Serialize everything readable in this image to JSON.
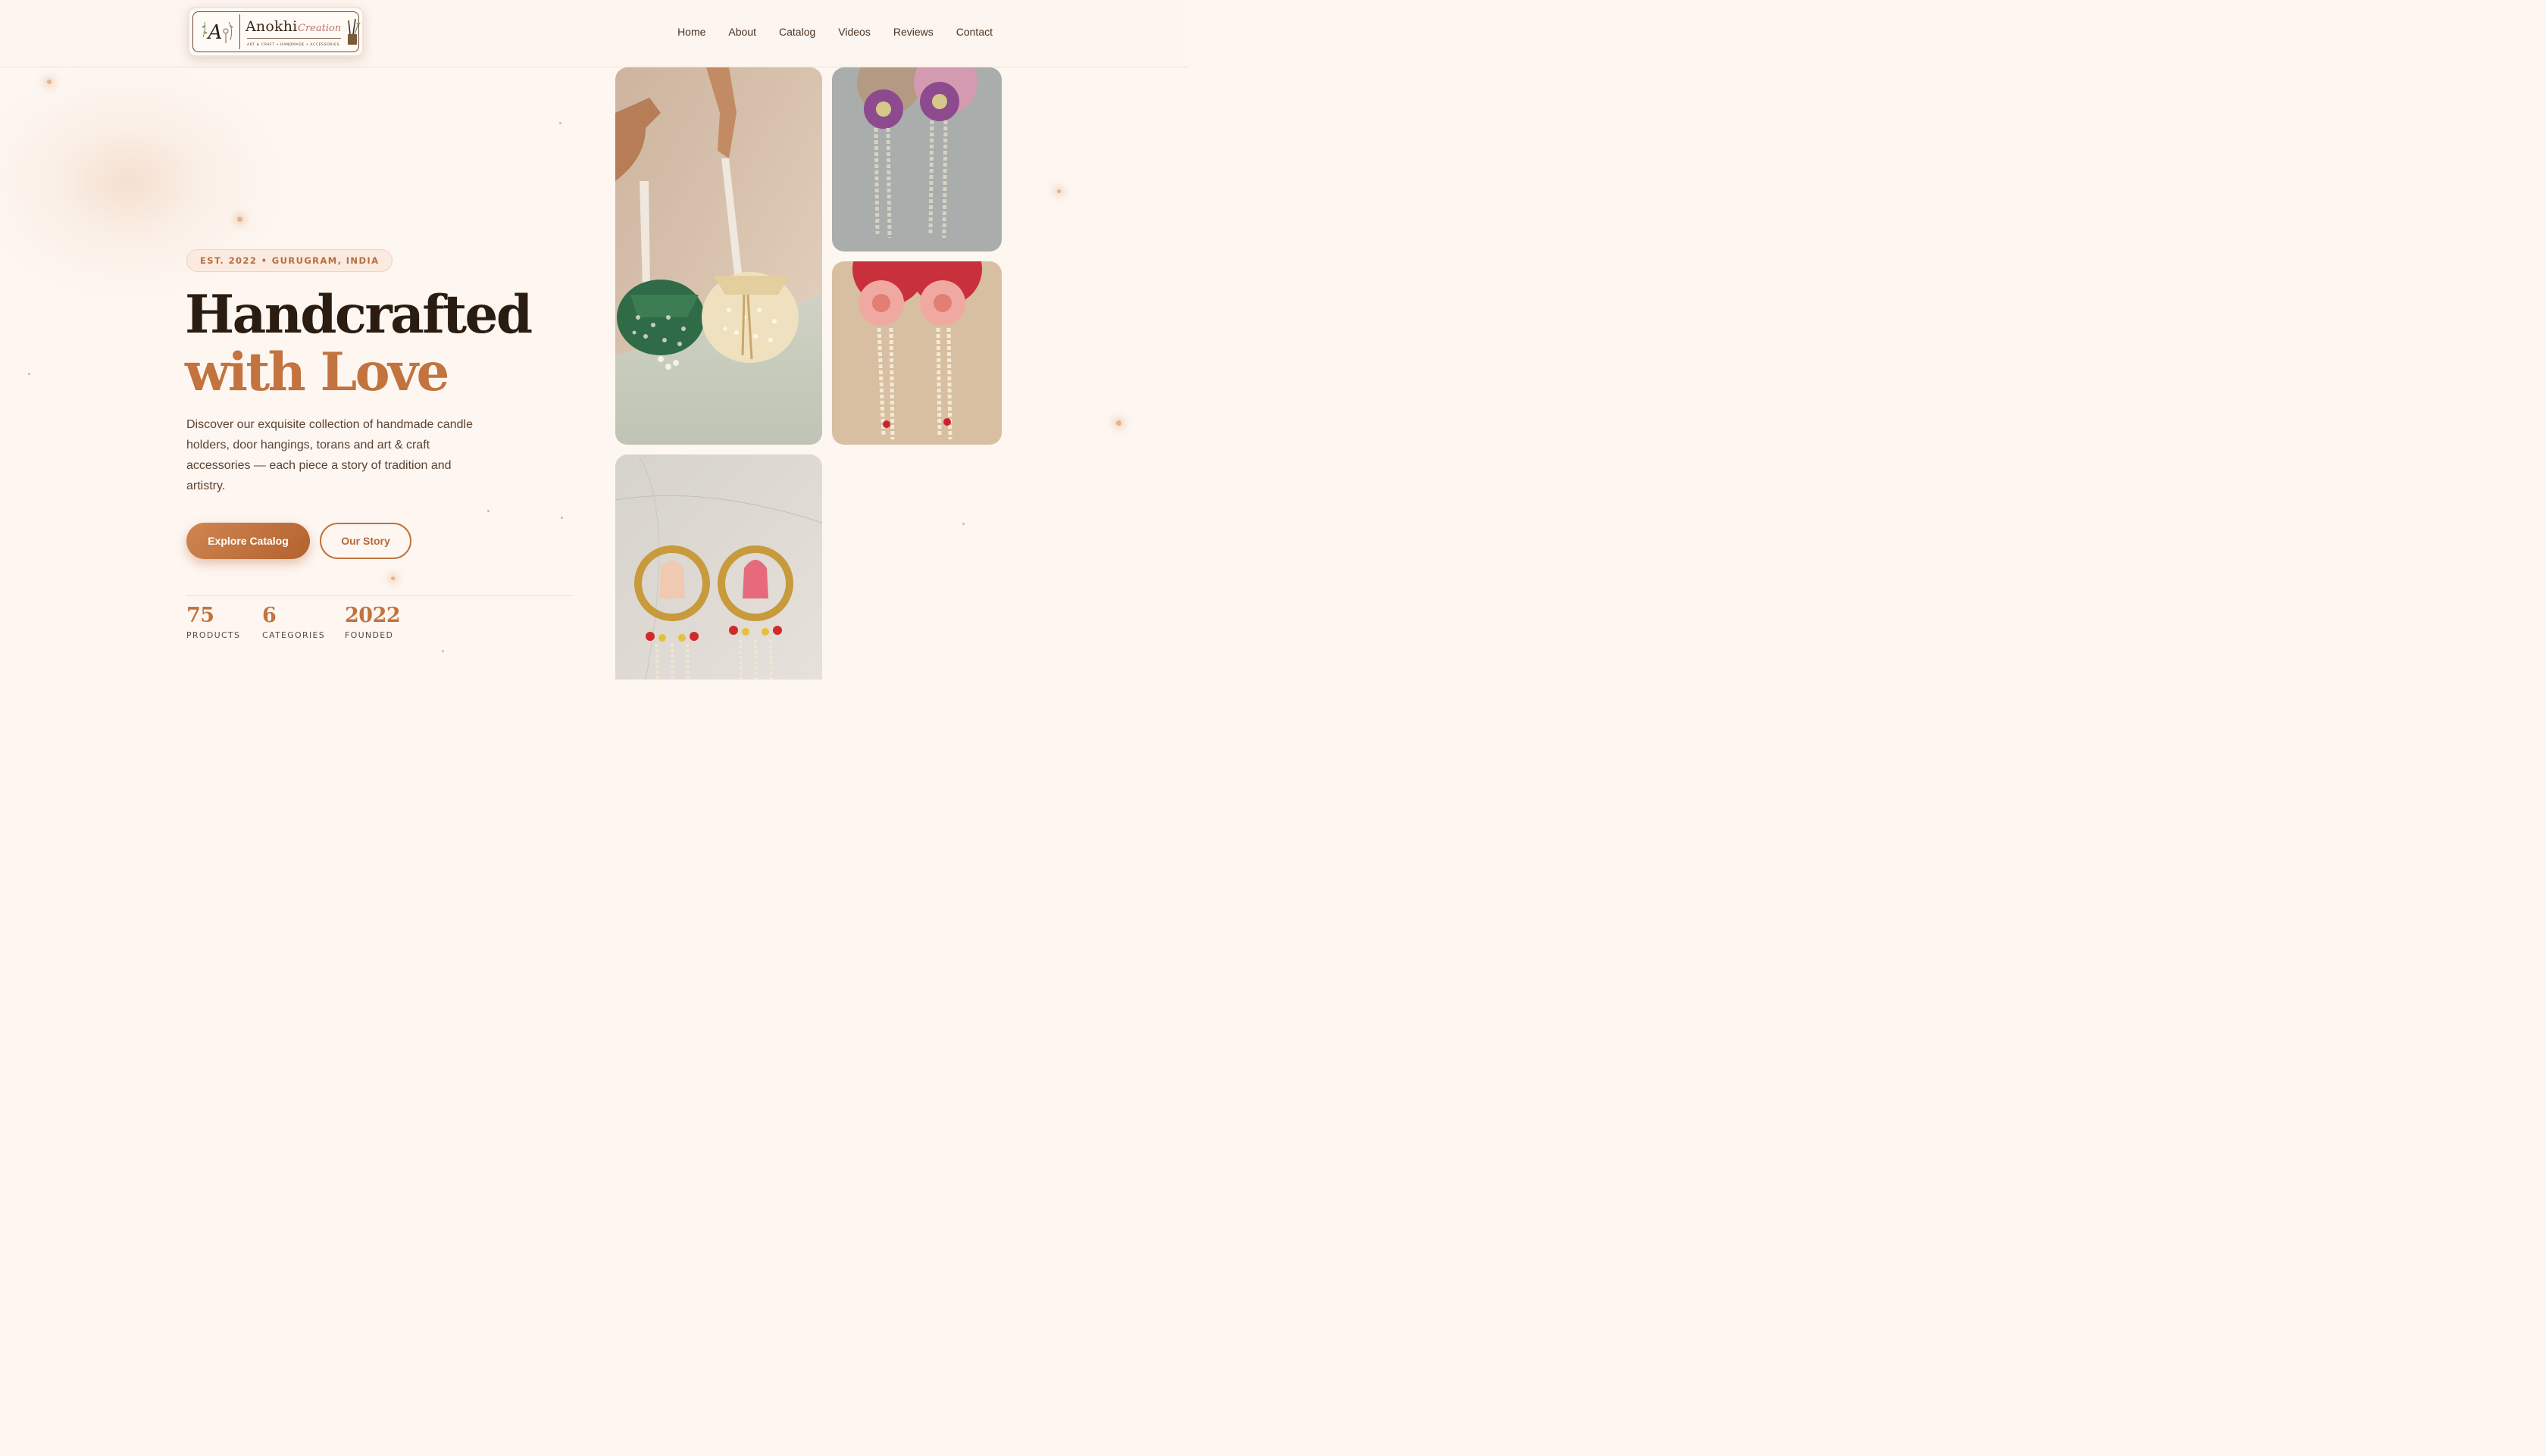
{
  "brand": {
    "name": "Anokhi",
    "name_suffix": "Creation",
    "tagline": "ART & CRAFT  •  HANDMADE  •  ACCESSORIES",
    "monogram": "A"
  },
  "nav": {
    "items": [
      {
        "label": "Home"
      },
      {
        "label": "About"
      },
      {
        "label": "Catalog"
      },
      {
        "label": "Videos"
      },
      {
        "label": "Reviews"
      },
      {
        "label": "Contact"
      }
    ]
  },
  "hero": {
    "badge": "EST. 2022 • GURUGRAM, INDIA",
    "title_line1": "Handcrafted",
    "title_line2": "with Love",
    "description": "Discover our exquisite collection of handmade candle holders, door hangings, torans and art & craft accessories — each piece a story of tradition and artistry.",
    "primary_button": "Explore Catalog",
    "secondary_button": "Our Story"
  },
  "stats": [
    {
      "value": "75",
      "label": "PRODUCTS"
    },
    {
      "value": "6",
      "label": "CATEGORIES"
    },
    {
      "value": "2022",
      "label": "FOUNDED"
    }
  ],
  "gallery": [
    {
      "name": "potli-bags-photo"
    },
    {
      "name": "purple-flower-hangings-photo"
    },
    {
      "name": "pink-flower-hangings-photo"
    },
    {
      "name": "ganesha-lakshmi-hangings-photo"
    }
  ],
  "colors": {
    "background": "#fdf6f1",
    "accent": "#c2733e",
    "heading": "#2a1c10",
    "badge_bg": "#fbeadf"
  }
}
